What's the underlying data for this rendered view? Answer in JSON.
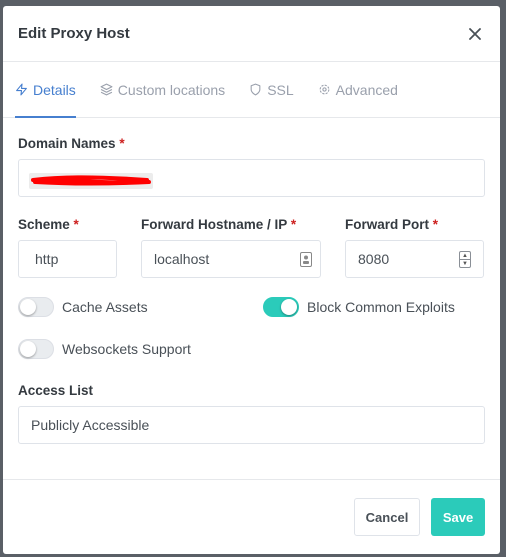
{
  "modal": {
    "title": "Edit Proxy Host"
  },
  "tabs": [
    {
      "label": "Details",
      "icon": "lightning-icon",
      "active": true
    },
    {
      "label": "Custom locations",
      "icon": "layers-icon",
      "active": false
    },
    {
      "label": "SSL",
      "icon": "shield-icon",
      "active": false
    },
    {
      "label": "Advanced",
      "icon": "gear-icon",
      "active": false
    }
  ],
  "form": {
    "domain_names_label": "Domain Names",
    "required_mark": "*",
    "scheme_label": "Scheme",
    "scheme_value": "http",
    "hostname_label": "Forward Hostname / IP",
    "hostname_value": "localhost",
    "port_label": "Forward Port",
    "port_value": "8080",
    "cache_assets_label": "Cache Assets",
    "cache_assets_on": false,
    "block_exploits_label": "Block Common Exploits",
    "block_exploits_on": true,
    "websockets_label": "Websockets Support",
    "websockets_on": false,
    "access_list_label": "Access List",
    "access_list_value": "Publicly Accessible"
  },
  "footer": {
    "cancel_label": "Cancel",
    "save_label": "Save"
  },
  "colors": {
    "accent": "#467fcf",
    "teal": "#2bcbba",
    "required": "#cd201f",
    "redaction": "#ff0000"
  }
}
